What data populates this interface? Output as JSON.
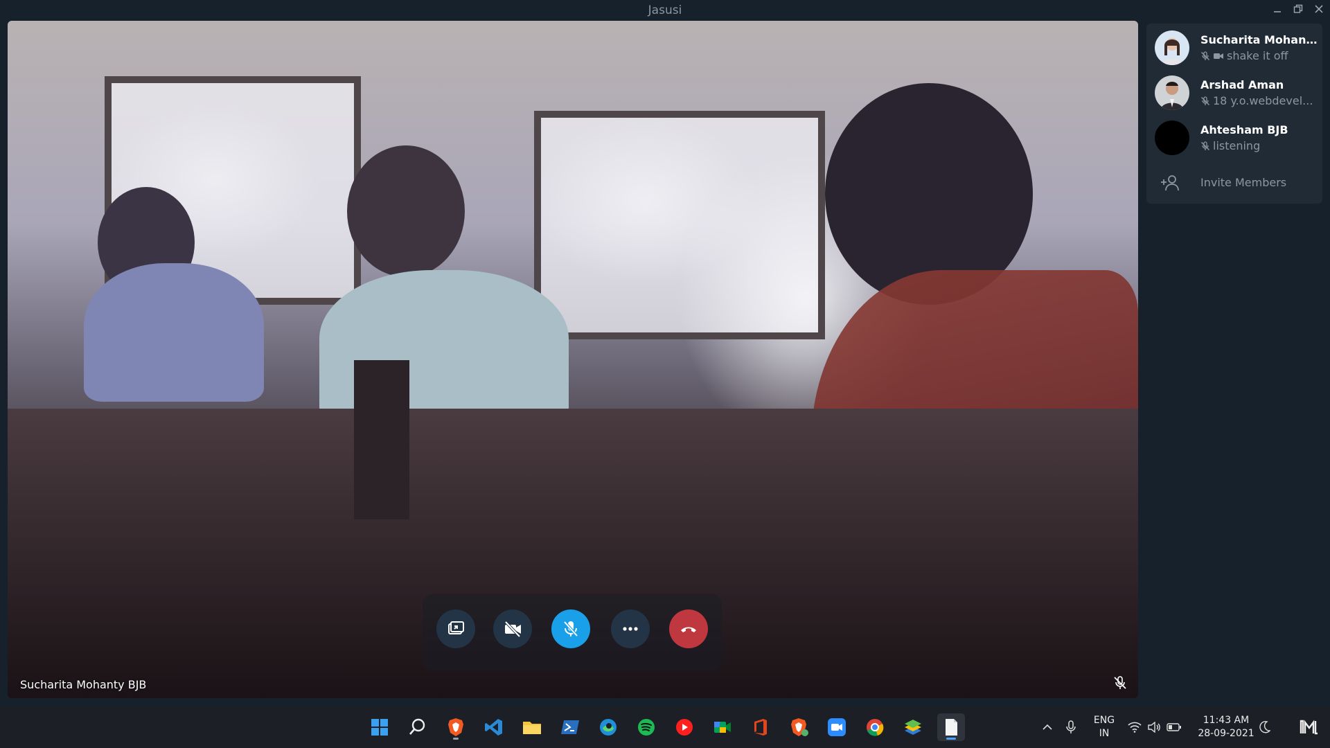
{
  "window": {
    "title": "Jasusi",
    "controls": {
      "minimize": "minimize-icon",
      "restore": "restore-icon",
      "close": "close-icon"
    }
  },
  "video": {
    "speaker_name": "Sucharita Mohanty BJB",
    "speaker_muted": true
  },
  "call_controls": [
    {
      "name": "screen-share",
      "icon": "screen-share-icon",
      "color": "#233447"
    },
    {
      "name": "camera",
      "icon": "video-off-icon",
      "color": "#233447"
    },
    {
      "name": "microphone",
      "icon": "mic-off-icon",
      "color": "#1aa0e8"
    },
    {
      "name": "more",
      "icon": "more-icon",
      "color": "#233447"
    },
    {
      "name": "end-call",
      "icon": "hang-up-icon",
      "color": "#c0383f"
    }
  ],
  "members": [
    {
      "name": "Sucharita Mohanty ...",
      "status": "shake it off",
      "icons": [
        "mic-off-icon",
        "video-icon"
      ]
    },
    {
      "name": "Arshad Aman",
      "status": "18 y.o.webdevel...",
      "icons": [
        "mic-off-icon"
      ]
    },
    {
      "name": "Ahtesham BJB",
      "status": "listening",
      "icons": [
        "mic-off-icon"
      ]
    }
  ],
  "invite": {
    "label": "Invite Members",
    "icon": "add-user-icon"
  },
  "taskbar": {
    "apps": [
      "windows-start-icon",
      "search-icon",
      "brave-icon",
      "vscode-icon",
      "file-explorer-icon",
      "powershell-icon",
      "edge-icon",
      "spotify-icon",
      "youtube-music-icon",
      "google-meet-icon",
      "office-icon",
      "brave-beta-icon",
      "zoom-icon",
      "chrome-icon",
      "bluestacks-icon",
      "notepad-icon"
    ],
    "language_line1": "ENG",
    "language_line2": "IN",
    "time": "11:43 AM",
    "date": "28-09-2021"
  },
  "colors": {
    "accent": "#1aa0e8",
    "hangup": "#c0383f",
    "panel": "#202b36",
    "background": "#17212b"
  }
}
